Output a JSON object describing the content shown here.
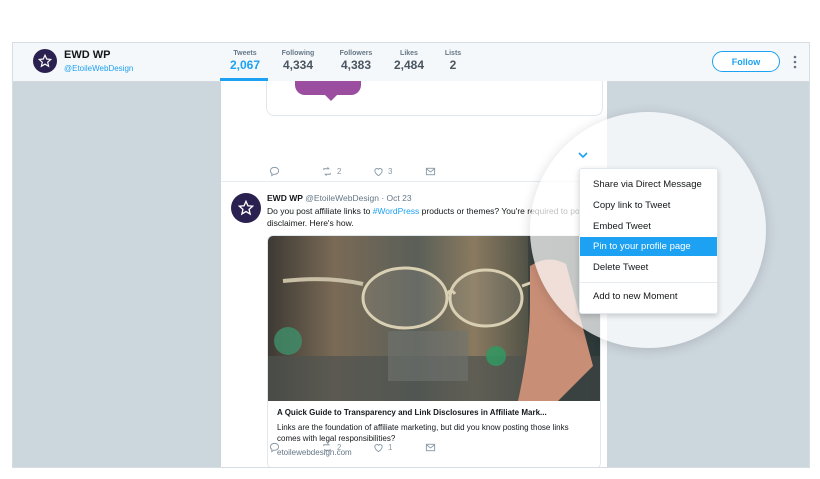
{
  "profile": {
    "name": "EWD WP",
    "handle": "@EtoileWebDesign"
  },
  "stats": [
    {
      "label": "Tweets",
      "value": "2,067",
      "active": true
    },
    {
      "label": "Following",
      "value": "4,334",
      "active": false
    },
    {
      "label": "Followers",
      "value": "4,383",
      "active": false
    },
    {
      "label": "Likes",
      "value": "2,484",
      "active": false
    },
    {
      "label": "Lists",
      "value": "2",
      "active": false
    }
  ],
  "follow_label": "Follow",
  "prev_tweet_actions": {
    "retweets": "2",
    "likes": "3"
  },
  "tweet": {
    "name": "EWD WP",
    "handle": "@EtoileWebDesign",
    "separator": "·",
    "date": "Oct 23",
    "text_before": "Do you post affiliate links to ",
    "hashtag": "#WordPress",
    "text_after": " products or themes? You're required to post a disclaimer. Here's how.",
    "card": {
      "title": "A Quick Guide to Transparency and Link Disclosures in Affiliate Mark...",
      "description": "Links are the foundation of affiliate marketing, but did you know posting those links comes with legal responsibilities?",
      "url": "etoilewebdesign.com"
    },
    "actions": {
      "retweets": "2",
      "likes": "1"
    }
  },
  "menu": {
    "items": [
      {
        "label": "Share via Direct Message",
        "highlighted": false
      },
      {
        "label": "Copy link to Tweet",
        "highlighted": false
      },
      {
        "label": "Embed Tweet",
        "highlighted": false
      },
      {
        "label": "Pin to your profile page",
        "highlighted": true
      },
      {
        "label": "Delete Tweet",
        "highlighted": false
      },
      {
        "label": "Add to new Moment",
        "highlighted": false
      }
    ]
  },
  "colors": {
    "accent": "#1da1f2",
    "avatar": "#2b2151",
    "background": "#ccd6dd"
  },
  "icons": [
    "star-logo-icon",
    "reply-icon",
    "retweet-icon",
    "like-icon",
    "message-icon",
    "chevron-down-icon",
    "more-vertical-icon"
  ]
}
